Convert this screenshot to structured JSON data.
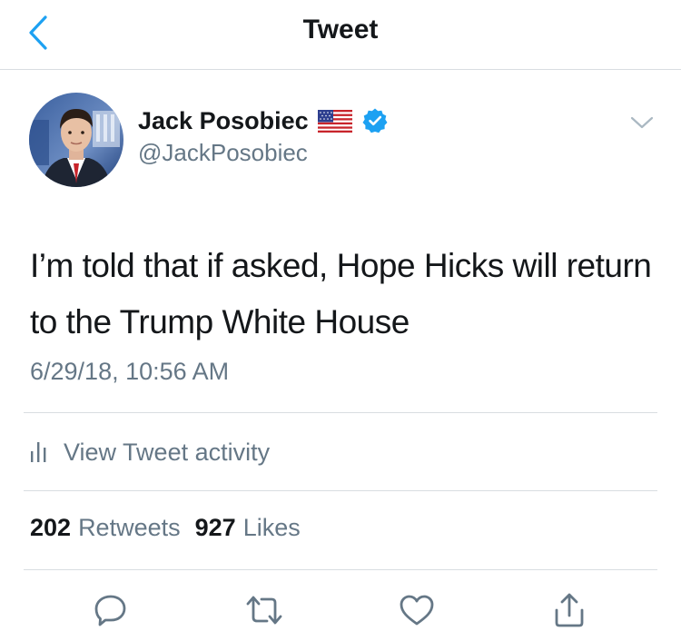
{
  "header": {
    "title": "Tweet",
    "back_icon": "chevron-left-icon"
  },
  "author": {
    "name": "Jack Posobiec",
    "handle": "@JackPosobiec",
    "flag_icon": "us-flag-icon",
    "verified_icon": "verified-badge-icon"
  },
  "tweet": {
    "text": "I’m told that if asked, Hope Hicks will return to the Trump White House",
    "timestamp": "6/29/18, 10:56 AM"
  },
  "activity": {
    "label": "View Tweet activity",
    "icon": "bar-chart-icon"
  },
  "stats": {
    "retweets_count": "202",
    "retweets_label": "Retweets",
    "likes_count": "927",
    "likes_label": "Likes"
  },
  "actions": [
    "reply-icon",
    "retweet-icon",
    "like-icon",
    "share-icon"
  ],
  "colors": {
    "accent": "#1da1f2",
    "text_primary": "#14171a",
    "text_secondary": "#657786",
    "divider": "#d8dde1"
  }
}
